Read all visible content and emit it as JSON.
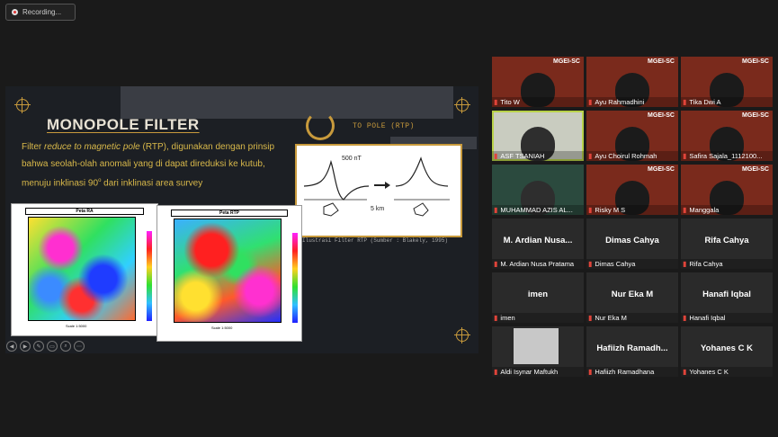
{
  "recording": {
    "label": "Recording..."
  },
  "slide": {
    "title": "MONOPOLE FILTER",
    "body_parts": [
      "Filter ",
      "reduce to magnetic pole",
      " (RTP), digunakan dengan prinsip bahwa seolah-olah anomali yang di dapat direduksi ke kutub, menuju inklinasi 90",
      "o",
      " dari inklinasi area survey"
    ],
    "to_pole": "TO POLE (RTP)",
    "figure": {
      "label_nt": "500 nT",
      "label_km": "5 km"
    },
    "caption": "Ilustrasi Filter RTP (Sumber : Blakely, 1995)",
    "map_left": {
      "title": "Peta RA",
      "scale": "Scale 1:5000"
    },
    "map_right": {
      "title": "Peta RTP",
      "scale": "Scale 1:5000"
    },
    "controls": [
      "◀",
      "▶",
      "✎",
      "▭",
      "⌕",
      "⋯"
    ]
  },
  "participants": [
    {
      "name": "Tito W",
      "type": "video",
      "logo": "MGEI-SC"
    },
    {
      "name": "Ayu Rahmadhini",
      "type": "video",
      "logo": "MGEI-SC"
    },
    {
      "name": "Tika Dwi A",
      "type": "video",
      "logo": "MGEI-SC"
    },
    {
      "name": "ASF TSANIAH",
      "type": "active",
      "logo": ""
    },
    {
      "name": "Ayu Choirul Rohmah",
      "type": "video",
      "logo": "MGEI-SC"
    },
    {
      "name": "Safira Sajala_1112100...",
      "type": "video",
      "logo": "MGEI-SC"
    },
    {
      "name": "MUHAMMAD AZIS AL...",
      "type": "green",
      "logo": ""
    },
    {
      "name": "Risky M S",
      "type": "video",
      "logo": "MGEI-SC"
    },
    {
      "name": "Manggala",
      "type": "video",
      "logo": "MGEI-SC"
    },
    {
      "name": "M. Ardian Nusa Pratama",
      "display": "M. Ardian  Nusa...",
      "type": "blank"
    },
    {
      "name": "Dimas Cahya",
      "display": "Dimas Cahya",
      "type": "blank"
    },
    {
      "name": "Rifa Cahya",
      "display": "Rifa Cahya",
      "type": "blank"
    },
    {
      "name": "imen",
      "display": "imen",
      "type": "blank"
    },
    {
      "name": "Nur Eka M",
      "display": "Nur Eka M",
      "type": "blank"
    },
    {
      "name": "Hanafi Iqbal",
      "display": "Hanafi Iqbal",
      "type": "blank"
    },
    {
      "name": "Aldi Isynar Maftukh",
      "display": "",
      "type": "photo"
    },
    {
      "name": "Hafiizh Ramadhana",
      "display": "Hafiizh  Ramadh...",
      "type": "blank"
    },
    {
      "name": "Yohanes C K",
      "display": "Yohanes C K",
      "type": "blank"
    }
  ],
  "colors": {
    "accent": "#c89a3c",
    "body_text": "#d8b84a",
    "brand_bg": "#7a2a1c",
    "active_outline": "#b9d24a",
    "muted_mic": "#e0443a"
  }
}
